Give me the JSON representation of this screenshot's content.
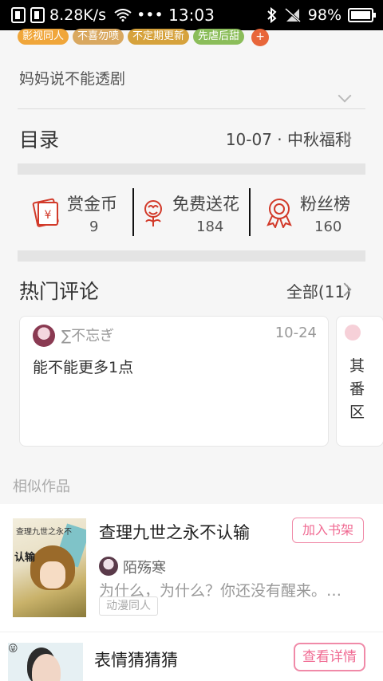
{
  "status_bar": {
    "network_speed": "8.28K/s",
    "dots": "•••",
    "time": "13:03",
    "battery": "98%",
    "battery_level": 0.98
  },
  "tags": [
    {
      "label": "影视同人",
      "color": "#f0a63a"
    },
    {
      "label": "不喜勿喷",
      "color": "#d9a860"
    },
    {
      "label": "不定期更新",
      "color": "#d6a23c"
    },
    {
      "label": "先虐后甜",
      "color": "#8bbd5a"
    }
  ],
  "tag_more": "+",
  "intro": "妈妈说不能透剧",
  "toc": {
    "title": "目录",
    "latest": "10-07 · 中秋福利"
  },
  "actions": [
    {
      "label": "赏金币",
      "count": "9",
      "icon": "red-envelope-icon"
    },
    {
      "label": "免费送花",
      "count": "184",
      "icon": "flower-icon"
    },
    {
      "label": "粉丝榜",
      "count": "160",
      "icon": "medal-icon"
    }
  ],
  "hot_comments": {
    "title": "热门评论",
    "all": "全部(11)",
    "items": [
      {
        "user": "∑不忘ぎ",
        "date": "10-24",
        "text": "能不能更多1点"
      },
      {
        "text": "其番区"
      }
    ]
  },
  "similar": {
    "title": "相似作品",
    "books": [
      {
        "title": "查理九世之永不认输",
        "author": "陌殇寒",
        "desc": "为什么，为什么？你还没有醒来。…",
        "tag": "动漫同人",
        "button": "加入书架",
        "cover_text_top": "查理九世之永不",
        "cover_text_main": "认输"
      },
      {
        "title": "表情猜猜猜",
        "button": "查看详情"
      }
    ]
  }
}
